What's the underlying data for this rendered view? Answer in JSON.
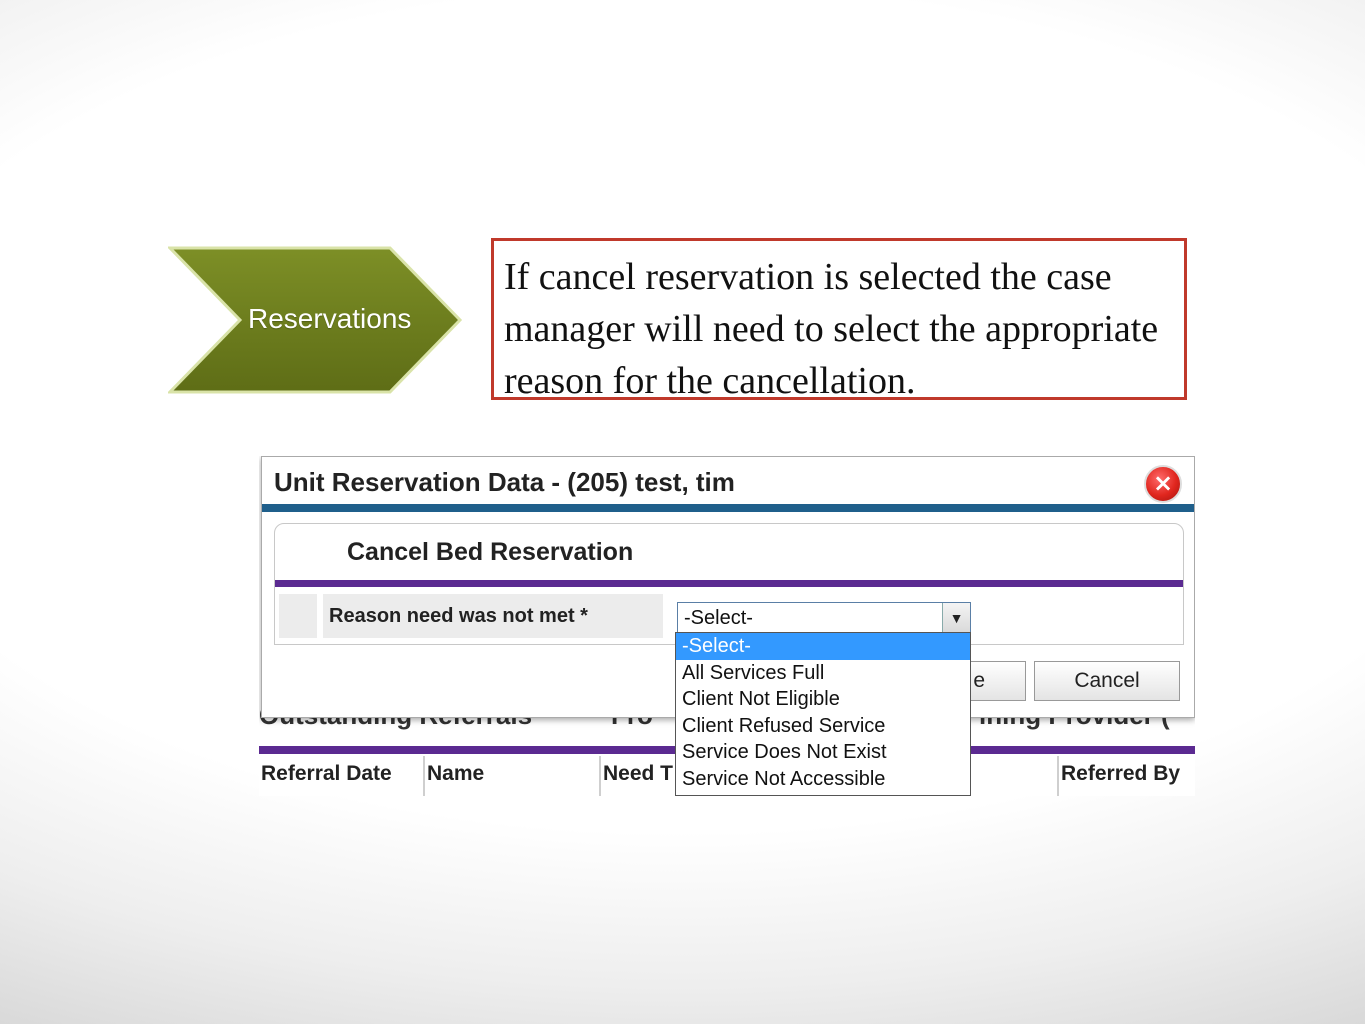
{
  "step": {
    "label": "Reservations"
  },
  "callout": {
    "text": "If cancel reservation is selected the case manager will need to select the appropriate reason for the cancellation."
  },
  "dialog": {
    "title": "Unit Reservation Data - (205) test, tim",
    "close_symbol": "×",
    "panel_title": "Cancel Bed Reservation",
    "field_label": "Reason need was not met *",
    "select_value": "-Select-",
    "select_arrow": "▼",
    "save_partial": "e",
    "cancel_label": "Cancel",
    "options": [
      "-Select-",
      "All Services Full",
      "Client Not Eligible",
      "Client Refused Service",
      "Service Does Not Exist",
      "Service Not Accessible"
    ]
  },
  "background": {
    "heading_left": "Outstanding Referrals",
    "heading_mid": "Fro",
    "heading_right": "ining Provider (",
    "columns": [
      "Referral Date",
      "Name",
      "Need T",
      "",
      "Referred By"
    ]
  },
  "colors": {
    "chevron": "#6a7a1e",
    "callout_border": "#c0392b",
    "title_bar": "#1f5f8b",
    "accent_bar": "#5b2a91",
    "selected_option": "#3399ff"
  }
}
